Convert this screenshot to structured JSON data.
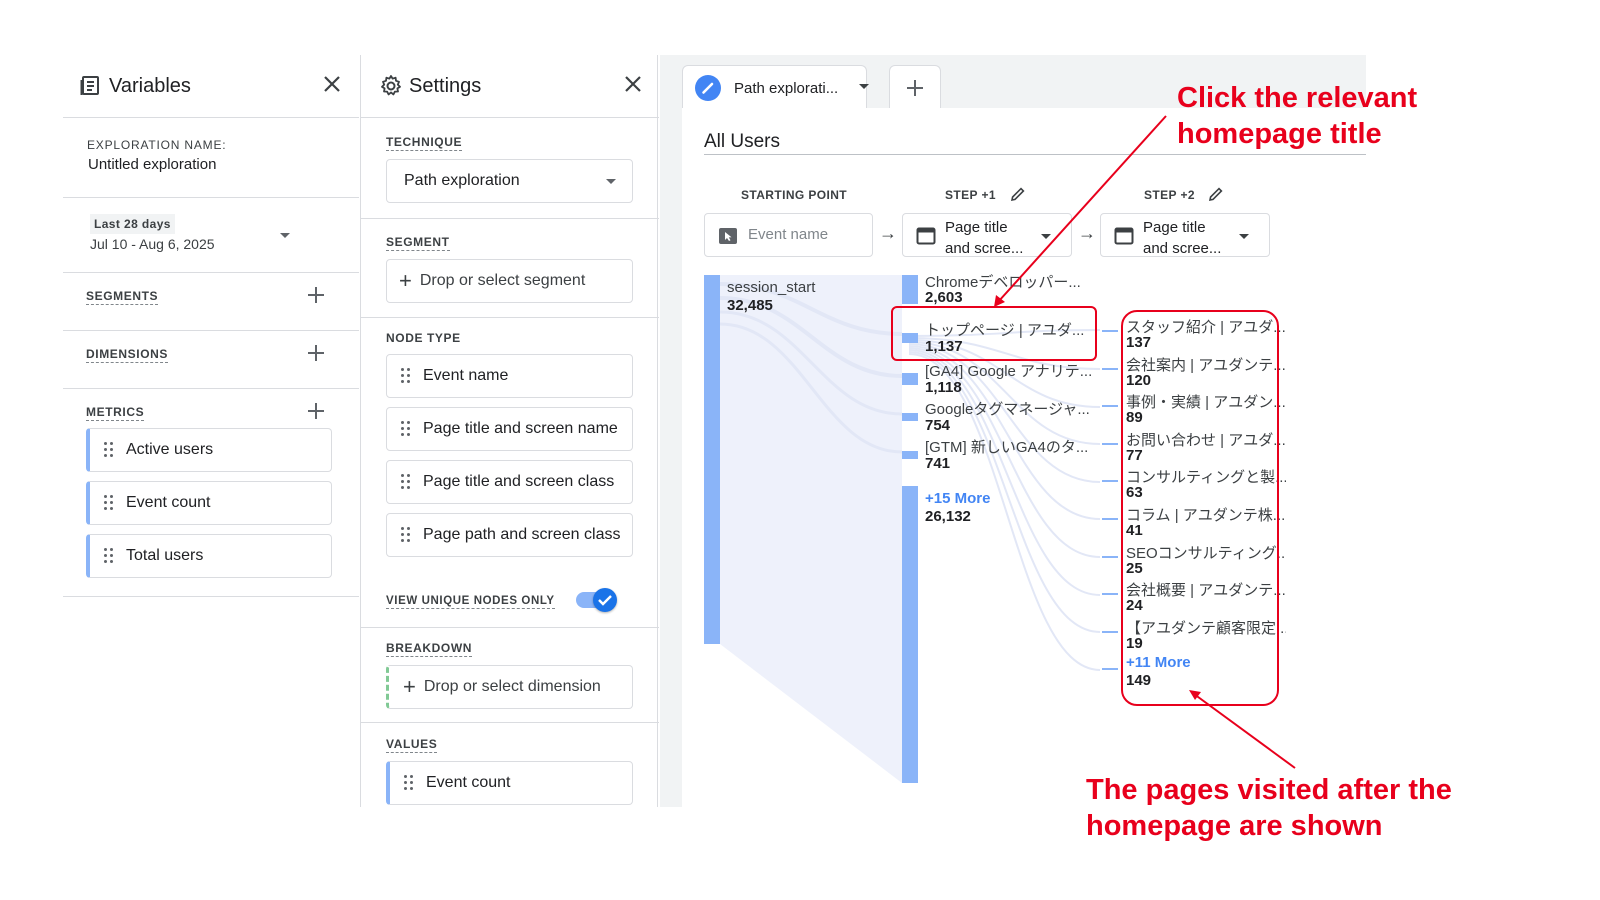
{
  "variables": {
    "title": "Variables",
    "exploration_name_label": "EXPLORATION NAME:",
    "exploration_name": "Untitled exploration",
    "date_range_label": "Last 28 days",
    "date_range": "Jul 10 - Aug 6, 2025",
    "segments_label": "SEGMENTS",
    "dimensions_label": "DIMENSIONS",
    "metrics_label": "METRICS",
    "metrics": [
      "Active users",
      "Event count",
      "Total users"
    ]
  },
  "settings": {
    "title": "Settings",
    "technique_label": "TECHNIQUE",
    "technique_value": "Path exploration",
    "segment_label": "SEGMENT",
    "segment_placeholder": "Drop or select segment",
    "node_type_label": "NODE TYPE",
    "node_types": [
      "Event name",
      "Page title and screen name",
      "Page title and screen class",
      "Page path and screen class"
    ],
    "unique_nodes_label": "VIEW UNIQUE NODES ONLY",
    "unique_nodes_on": true,
    "breakdown_label": "BREAKDOWN",
    "breakdown_placeholder": "Drop or select dimension",
    "values_label": "VALUES",
    "values_item": "Event count"
  },
  "canvas": {
    "tab_label": "Path explorati...",
    "segment_title": "All Users",
    "starting_point_label": "STARTING POINT",
    "step1_label": "STEP +1",
    "step2_label": "STEP +2",
    "start_selector": "Event name",
    "step1_selector_line1": "Page title",
    "step1_selector_line2": "and scree...",
    "step2_selector_line1": "Page title",
    "step2_selector_line2": "and scree...",
    "start_node": {
      "label": "session_start",
      "value": "32,485"
    },
    "step1_nodes": [
      {
        "label": "Chromeデベロッパー...",
        "value": "2,603"
      },
      {
        "label": "トップページ | アユダ...",
        "value": "1,137"
      },
      {
        "label": "[GA4] Google アナリテ...",
        "value": "1,118"
      },
      {
        "label": "Googleタグマネージャ...",
        "value": "754"
      },
      {
        "label": "[GTM] 新しいGA4のタ...",
        "value": "741"
      }
    ],
    "step1_more": {
      "label": "+15 More",
      "value": "26,132"
    },
    "step2_nodes": [
      {
        "label": "スタッフ紹介 | アユダ...",
        "value": "137"
      },
      {
        "label": "会社案内 | アユダンテ...",
        "value": "120"
      },
      {
        "label": "事例・実績 | アユダン...",
        "value": "89"
      },
      {
        "label": "お問い合わせ | アユダ...",
        "value": "77"
      },
      {
        "label": "コンサルティングと製...",
        "value": "63"
      },
      {
        "label": "コラム | アユダンテ株...",
        "value": "41"
      },
      {
        "label": "SEOコンサルティング...",
        "value": "25"
      },
      {
        "label": "会社概要 | アユダンテ...",
        "value": "24"
      },
      {
        "label": "【アユダンテ顧客限定...",
        "value": "19"
      }
    ],
    "step2_more": {
      "label": "+11 More",
      "value": "149"
    }
  },
  "annotations": {
    "top_line1": "Click the relevant",
    "top_line2": "homepage title",
    "bottom_line1": "The pages visited after the",
    "bottom_line2": "homepage are shown",
    "color": "#e8001c"
  },
  "colors": {
    "accent": "#8ab4f8",
    "primary": "#4285f4",
    "link": "#4285f4"
  }
}
